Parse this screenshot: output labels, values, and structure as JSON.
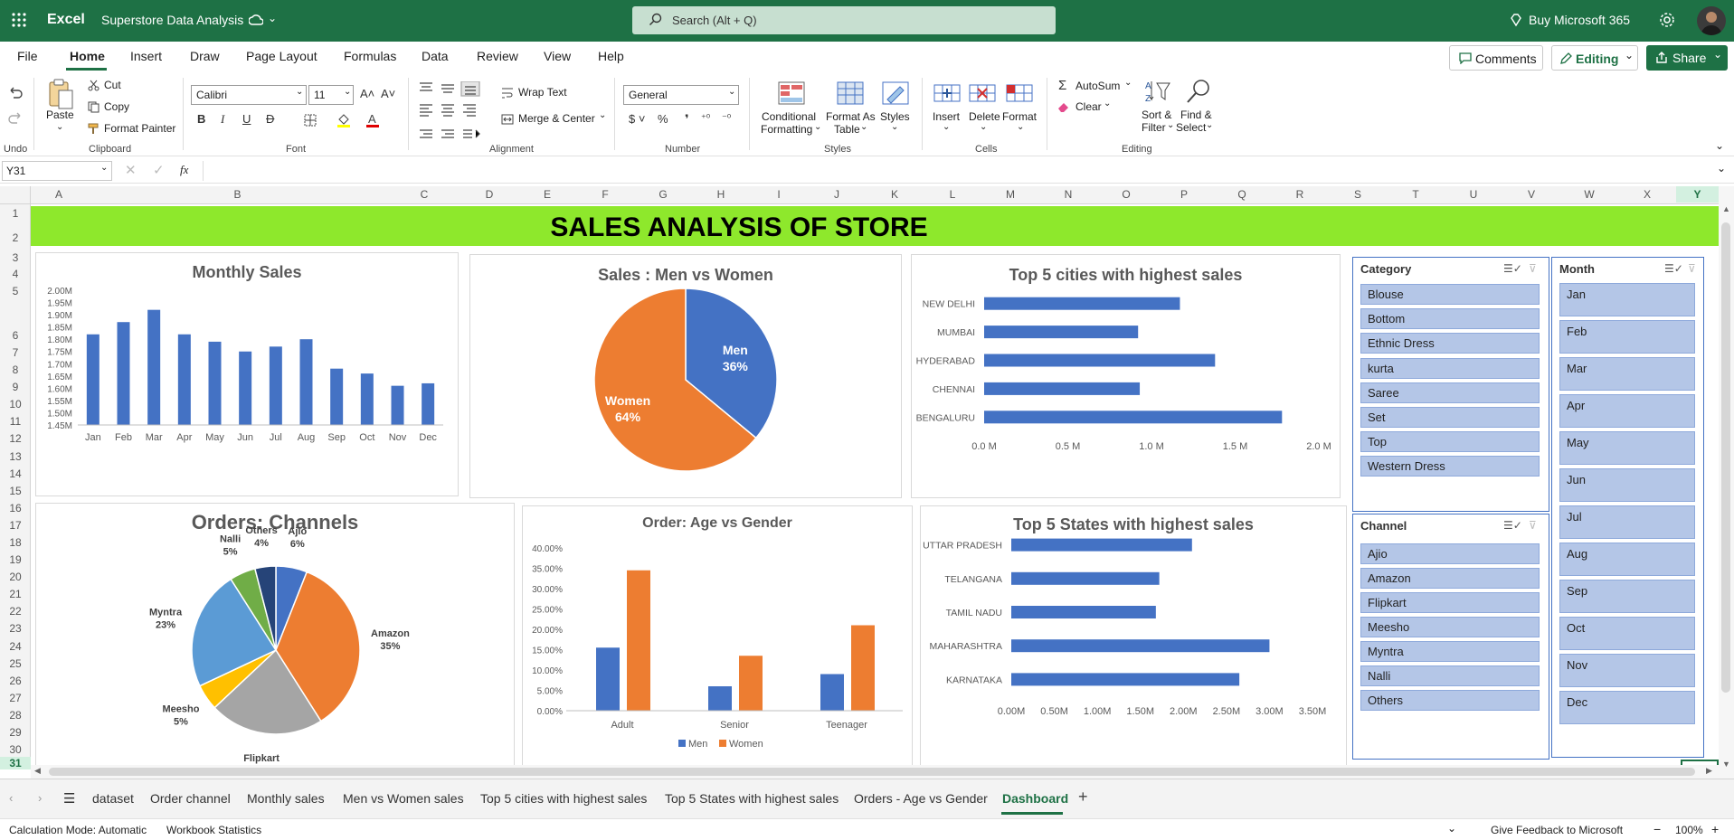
{
  "app": {
    "name": "Excel",
    "doc_title": "Superstore Data Analysis",
    "search_placeholder": "Search (Alt + Q)",
    "buy": "Buy Microsoft 365"
  },
  "menu": {
    "items": [
      "File",
      "Home",
      "Insert",
      "Draw",
      "Page Layout",
      "Formulas",
      "Data",
      "Review",
      "View",
      "Help"
    ],
    "active": "Home",
    "comments": "Comments",
    "editing": "Editing",
    "share": "Share"
  },
  "ribbon": {
    "undo_label": "Undo",
    "clipboard": {
      "paste": "Paste",
      "cut": "Cut",
      "copy": "Copy",
      "format_painter": "Format Painter",
      "group": "Clipboard"
    },
    "font": {
      "name": "Calibri",
      "size": "11",
      "group": "Font"
    },
    "alignment": {
      "wrap": "Wrap Text",
      "merge": "Merge & Center",
      "group": "Alignment"
    },
    "number": {
      "format": "General",
      "group": "Number"
    },
    "styles": {
      "cond1": "Conditional",
      "cond2": "Formatting",
      "fat1": "Format As",
      "fat2": "Table",
      "styles": "Styles",
      "group": "Styles"
    },
    "cells": {
      "insert": "Insert",
      "delete": "Delete",
      "format": "Format",
      "group": "Cells"
    },
    "editing": {
      "autosum": "AutoSum",
      "clear": "Clear",
      "sort1": "Sort &",
      "sort2": "Filter",
      "find1": "Find &",
      "find2": "Select",
      "group": "Editing"
    }
  },
  "formula_bar": {
    "name_box": "Y31",
    "fx": "fx",
    "content": ""
  },
  "grid": {
    "columns": [
      "A",
      "B",
      "C",
      "D",
      "E",
      "F",
      "G",
      "H",
      "I",
      "J",
      "K",
      "L",
      "M",
      "N",
      "O",
      "P",
      "Q",
      "R",
      "S",
      "T",
      "U",
      "V",
      "W",
      "X",
      "Y"
    ],
    "rows": [
      "1",
      "2",
      "3",
      "4",
      "5",
      "6",
      "7",
      "8",
      "9",
      "10",
      "11",
      "12",
      "13",
      "14",
      "15",
      "16",
      "17",
      "18",
      "19",
      "20",
      "21",
      "22",
      "23",
      "24",
      "25",
      "26",
      "27",
      "28",
      "29",
      "30",
      "31"
    ]
  },
  "banner": {
    "title": "SALES ANALYSIS OF STORE",
    "color": "#8ee82c"
  },
  "colors": {
    "blue": "#4472c4",
    "orange": "#ed7d31",
    "grey": "#a5a5a5",
    "yellow": "#ffc000",
    "lightblue": "#5b9bd5",
    "green": "#70ad47",
    "navy": "#264478",
    "excel_green": "#1e7145"
  },
  "chart_data": [
    {
      "id": "monthly_sales",
      "type": "bar",
      "title": "Monthly Sales",
      "categories": [
        "Jan",
        "Feb",
        "Mar",
        "Apr",
        "May",
        "Jun",
        "Jul",
        "Aug",
        "Sep",
        "Oct",
        "Nov",
        "Dec"
      ],
      "values": [
        1.82,
        1.87,
        1.92,
        1.82,
        1.79,
        1.75,
        1.77,
        1.8,
        1.68,
        1.66,
        1.61,
        1.62
      ],
      "y_ticks": [
        "1.45M",
        "1.50M",
        "1.55M",
        "1.60M",
        "1.65M",
        "1.70M",
        "1.75M",
        "1.80M",
        "1.85M",
        "1.90M",
        "1.95M",
        "2.00M"
      ],
      "ylim": [
        1.45,
        2.0
      ]
    },
    {
      "id": "men_women",
      "type": "pie",
      "title": "Sales : Men vs Women",
      "slices": [
        {
          "label": "Men",
          "pct": "36%",
          "value": 36
        },
        {
          "label": "Women",
          "pct": "64%",
          "value": 64
        }
      ]
    },
    {
      "id": "top_cities",
      "type": "bar",
      "orientation": "horizontal",
      "title": "Top 5 cities with highest sales",
      "categories": [
        "NEW DELHI",
        "MUMBAI",
        "HYDERABAD",
        "CHENNAI",
        "BENGALURU"
      ],
      "values": [
        1.17,
        0.92,
        1.38,
        0.93,
        1.78
      ],
      "x_ticks": [
        "0.0 M",
        "0.5 M",
        "1.0 M",
        "1.5 M",
        "2.0 M"
      ],
      "xlim": [
        0,
        2.0
      ]
    },
    {
      "id": "channels",
      "type": "pie",
      "title": "Orders: Channels",
      "slices": [
        {
          "label": "Ajio",
          "pct": "6%",
          "value": 6
        },
        {
          "label": "Amazon",
          "pct": "35%",
          "value": 35
        },
        {
          "label": "Flipkart",
          "pct": "22%",
          "value": 22
        },
        {
          "label": "Meesho",
          "pct": "5%",
          "value": 5
        },
        {
          "label": "Myntra",
          "pct": "23%",
          "value": 23
        },
        {
          "label": "Nalli",
          "pct": "5%",
          "value": 5
        },
        {
          "label": "Others",
          "pct": "4%",
          "value": 4
        }
      ]
    },
    {
      "id": "age_gender",
      "type": "bar",
      "title": "Order: Age vs Gender",
      "categories": [
        "Adult",
        "Senior",
        "Teenager"
      ],
      "series": [
        {
          "name": "Men",
          "values": [
            15.5,
            6.0,
            9.0
          ]
        },
        {
          "name": "Women",
          "values": [
            34.5,
            13.5,
            21.0
          ]
        }
      ],
      "y_ticks": [
        "0.00%",
        "5.00%",
        "10.00%",
        "15.00%",
        "20.00%",
        "25.00%",
        "30.00%",
        "35.00%",
        "40.00%"
      ],
      "ylim": [
        0,
        40
      ]
    },
    {
      "id": "top_states",
      "type": "bar",
      "orientation": "horizontal",
      "title": "Top 5 States with highest sales",
      "categories": [
        "UTTAR PRADESH",
        "TELANGANA",
        "TAMIL NADU",
        "MAHARASHTRA",
        "KARNATAKA"
      ],
      "values": [
        2.1,
        1.72,
        1.68,
        3.0,
        2.65
      ],
      "x_ticks": [
        "0.00M",
        "0.50M",
        "1.00M",
        "1.50M",
        "2.00M",
        "2.50M",
        "3.00M",
        "3.50M"
      ],
      "xlim": [
        0,
        3.5
      ]
    }
  ],
  "slicers": {
    "category": {
      "title": "Category",
      "items": [
        "Blouse",
        "Bottom",
        "Ethnic Dress",
        "kurta",
        "Saree",
        "Set",
        "Top",
        "Western Dress"
      ]
    },
    "channel": {
      "title": "Channel",
      "items": [
        "Ajio",
        "Amazon",
        "Flipkart",
        "Meesho",
        "Myntra",
        "Nalli",
        "Others"
      ]
    },
    "month": {
      "title": "Month",
      "items": [
        "Jan",
        "Feb",
        "Mar",
        "Apr",
        "May",
        "Jun",
        "Jul",
        "Aug",
        "Sep",
        "Oct",
        "Nov",
        "Dec"
      ]
    }
  },
  "sheet_tabs": {
    "items": [
      "dataset",
      "Order channel",
      "Monthly sales",
      "Men vs Women sales",
      "Top 5 cities with highest sales",
      "Top 5 States with highest sales",
      "Orders - Age vs Gender",
      "Dashboard"
    ],
    "active": "Dashboard"
  },
  "status": {
    "calc": "Calculation Mode: Automatic",
    "stats": "Workbook Statistics",
    "feedback": "Give Feedback to Microsoft",
    "zoom": "100%"
  }
}
